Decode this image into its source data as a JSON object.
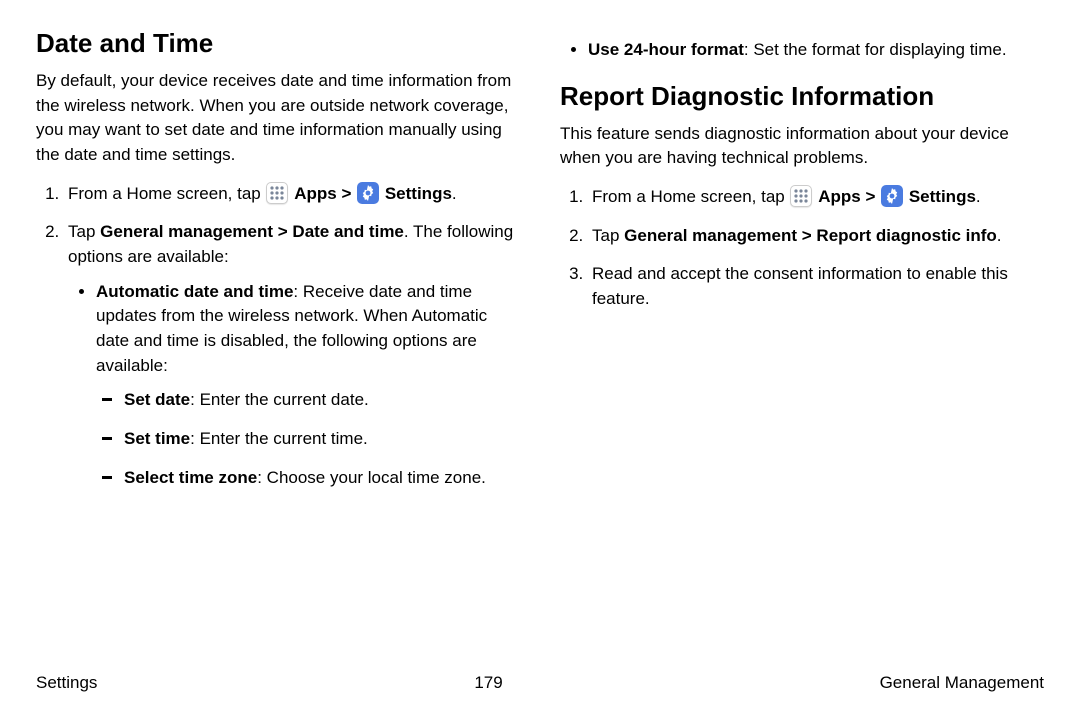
{
  "footer": {
    "left": "Settings",
    "center": "179",
    "right": "General Management"
  },
  "left": {
    "heading": "Date and Time",
    "intro": "By default, your device receives date and time information from the wireless network. When you are outside network coverage, you may want to set date and time information manually using the date and time settings.",
    "step1_prefix": "From a Home screen, tap ",
    "apps_label": "Apps",
    "chevron": ">",
    "settings_label": "Settings",
    "step1_suffix": ".",
    "step2_prefix": "Tap ",
    "step2_bold": "General management > Date and time",
    "step2_suffix": ". The following options are available:",
    "auto_label": "Automatic date and time",
    "auto_text": ": Receive date and time updates from the wireless network. When Automatic date and time is disabled, the following options are available:",
    "set_date_label": "Set date",
    "set_date_text": ": Enter the current date.",
    "set_time_label": "Set time",
    "set_time_text": ": Enter the current time.",
    "tz_label": "Select time zone",
    "tz_text": ": Choose your local time zone."
  },
  "right": {
    "use24_label": "Use 24-hour format",
    "use24_text": ": Set the format for displaying time.",
    "heading": "Report Diagnostic Information",
    "intro": "This feature sends diagnostic information about your device when you are having technical problems.",
    "step1_prefix": "From a Home screen, tap ",
    "apps_label": "Apps",
    "chevron": ">",
    "settings_label": "Settings",
    "step1_suffix": ".",
    "step2_prefix": "Tap ",
    "step2_bold": "General management > Report diagnostic info",
    "step2_suffix": ".",
    "step3": "Read and accept the consent information to enable this feature."
  }
}
